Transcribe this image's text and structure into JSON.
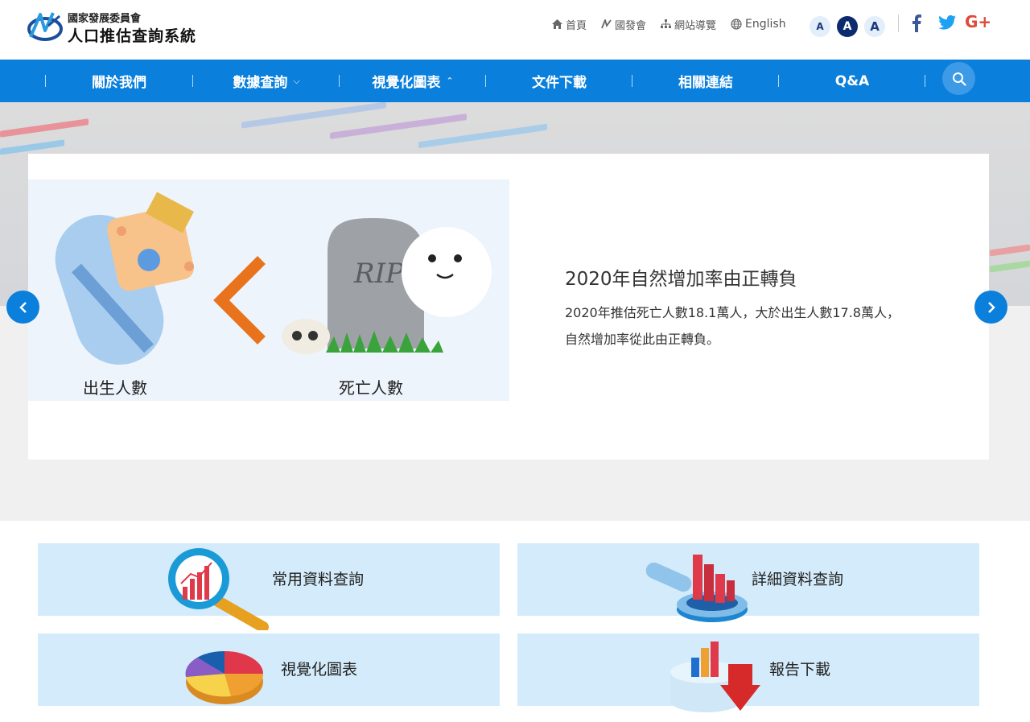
{
  "header": {
    "org_name": "國家發展委員會",
    "system_name": "人口推估查詢系統",
    "top_links": {
      "home": "首頁",
      "ndc": "國發會",
      "sitemap": "網站導覽",
      "english": "English"
    },
    "font_sizes": {
      "small": "A",
      "medium": "A",
      "large": "A"
    },
    "social": {
      "facebook": "f",
      "google_plus": "G+"
    }
  },
  "nav": {
    "items": [
      {
        "label": "關於我們"
      },
      {
        "label": "數據查詢",
        "chevron": "⌵"
      },
      {
        "label": "視覺化圖表",
        "chevron": "⌃"
      },
      {
        "label": "文件下載"
      },
      {
        "label": "相關連結"
      },
      {
        "label": "Q&A"
      }
    ]
  },
  "slide": {
    "birth_label": "出生人數",
    "death_label": "死亡人數",
    "rip_text": "RIP",
    "title": "2020年自然增加率由正轉負",
    "text_line1": "2020年推估死亡人數18.1萬人，大於出生人數17.8萬人，",
    "text_line2": "自然增加率從此由正轉負。"
  },
  "quick_links": {
    "common_query": "常用資料查詢",
    "detail_query": "詳細資料查詢",
    "visual_charts": "視覺化圖表",
    "report_download": "報告下載"
  },
  "colors": {
    "nav_blue": "#0a7fdc",
    "tile_bg": "#d3ebfa",
    "font_btn_active": "#0c2a6e"
  }
}
